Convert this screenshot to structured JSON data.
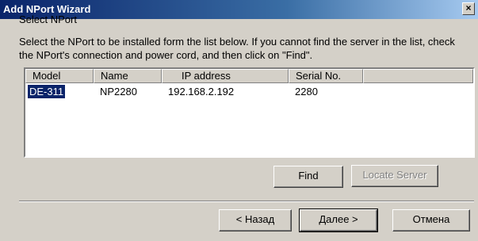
{
  "window": {
    "title": "Add NPort Wizard",
    "close_label": "×"
  },
  "page": {
    "section_title": "Select NPort",
    "instruction": "Select the NPort to be installed form the list below. If you cannot find the server in the list, check the NPort's connection and power cord, and then click on \"Find\"."
  },
  "list": {
    "columns": [
      "Model",
      "Name",
      "IP address",
      "Serial No."
    ],
    "rows": [
      {
        "model": "DE-311",
        "name": "NP2280",
        "ip": "192.168.2.192",
        "serial": "2280",
        "selected": true
      }
    ]
  },
  "buttons": {
    "find": "Find",
    "locate": "Locate Server",
    "back": "< Назад",
    "next": "Далее >",
    "cancel": "Отмена"
  }
}
